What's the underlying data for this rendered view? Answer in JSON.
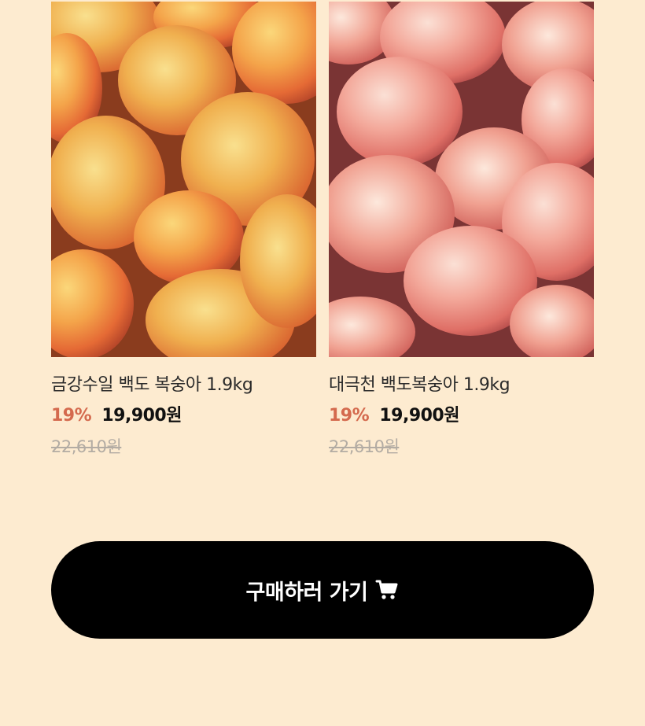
{
  "products": [
    {
      "name": "금강수일 백도 복숭아 1.9kg",
      "discount": "19%",
      "sale_price": "19,900원",
      "original_price": "22,610원",
      "image_icon": "yellow-peaches-photo"
    },
    {
      "name": "대극천 백도복숭아 1.9kg",
      "discount": "19%",
      "sale_price": "19,900원",
      "original_price": "22,610원",
      "image_icon": "white-peaches-photo"
    }
  ],
  "cta": {
    "label": "구매하러 가기",
    "icon": "cart-icon"
  },
  "colors": {
    "background": "#fdebd0",
    "discount": "#d46a4e",
    "button": "#000000",
    "strikethrough": "#b3aca3"
  }
}
